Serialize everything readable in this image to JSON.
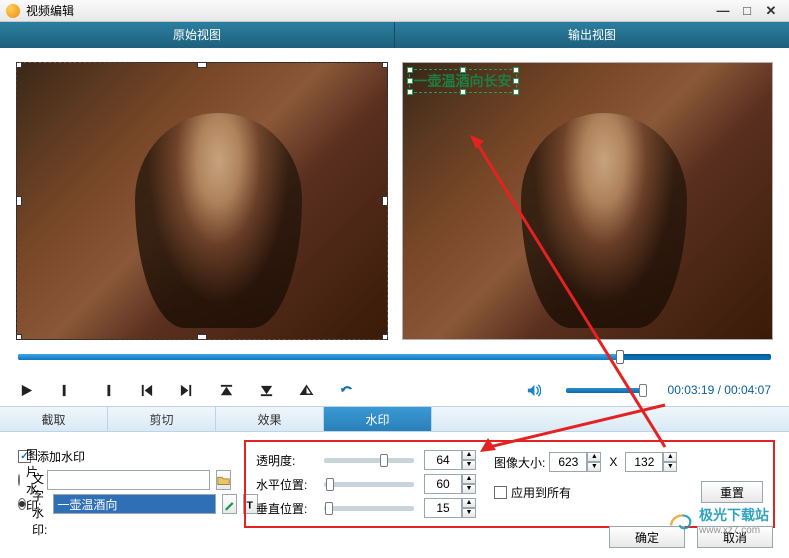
{
  "window": {
    "title": "视频编辑"
  },
  "header": {
    "original": "原始视图",
    "output": "输出视图"
  },
  "watermark_text": "一壶温酒向长安",
  "playback": {
    "current": "00:03:19",
    "total": "00:04:07"
  },
  "tabs": {
    "crop": "截取",
    "trim": "剪切",
    "effect": "效果",
    "watermark": "水印"
  },
  "wm_panel": {
    "add": "添加水印",
    "image": "图片水印:",
    "text": "文字水印:",
    "text_value": "一壶温酒向"
  },
  "sliders": {
    "opacity_label": "透明度:",
    "opacity": "64",
    "hpos_label": "水平位置:",
    "hpos": "60",
    "vpos_label": "垂直位置:",
    "vpos": "15"
  },
  "image_size": {
    "label": "图像大小:",
    "w": "623",
    "x": "X",
    "h": "132",
    "apply_all": "应用到所有",
    "reset": "重置"
  },
  "footer": {
    "ok": "确定",
    "cancel": "取消"
  },
  "brand": {
    "name": "极光下载站",
    "url": "www.xz7.com"
  }
}
